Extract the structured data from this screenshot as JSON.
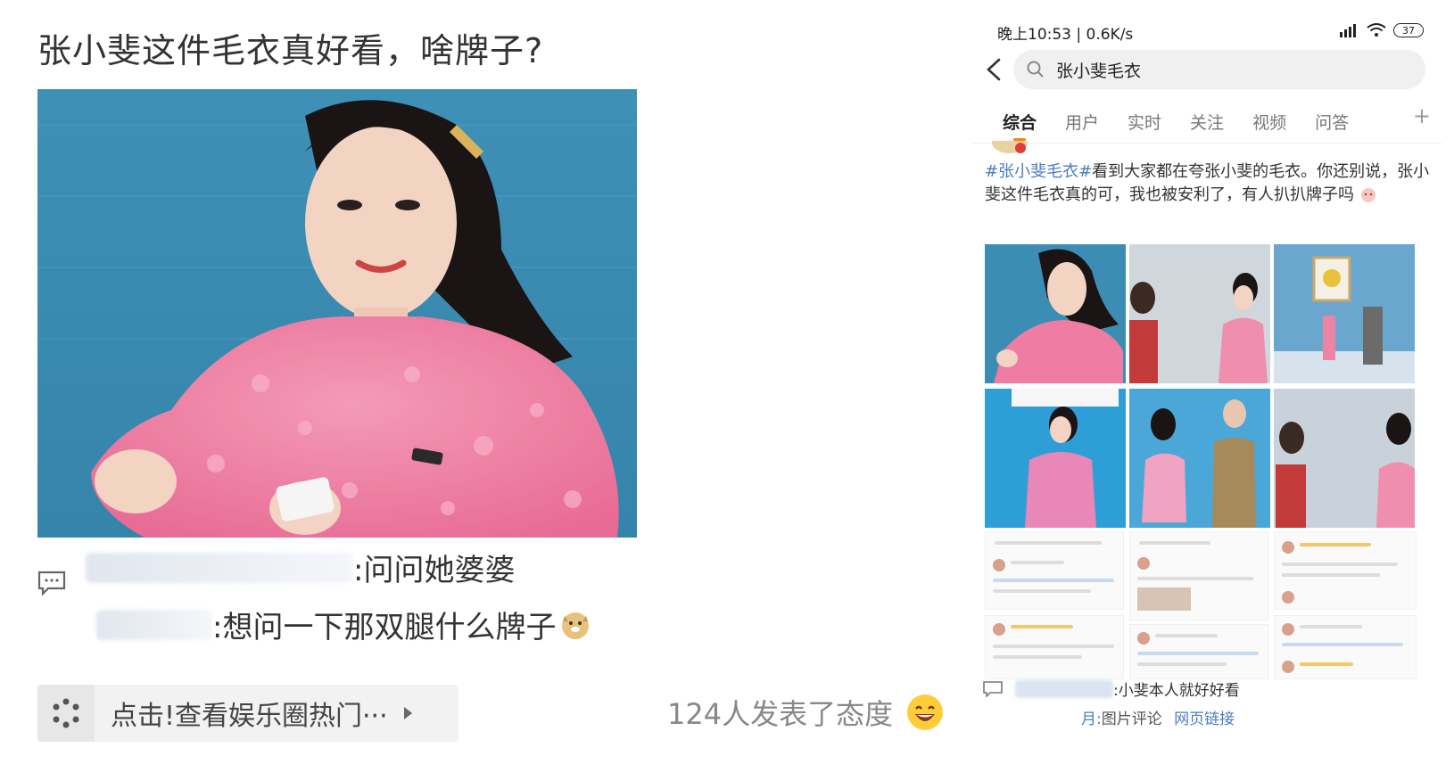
{
  "post": {
    "title": "张小斐这件毛衣真好看，啥牌子?",
    "comment1_text": ":问问她婆婆",
    "comment2_text": ":想问一下那双腿什么牌子",
    "hot_banner_label": "点击!查看娱乐圈热门···",
    "attitude_text": "124人发表了态度"
  },
  "phone": {
    "status_time": "晚上10:53 | 0.6K/s",
    "battery": "37",
    "search_query": "张小斐毛衣",
    "tabs": [
      "综合",
      "用户",
      "实时",
      "关注",
      "视频",
      "问答"
    ],
    "tab_plus": "+",
    "feed": {
      "hashtag": "#张小斐毛衣#",
      "text": "看到大家都在夸张小斐的毛衣。你还别说，张小斐这件毛衣真的可，我也被安利了，有人扒扒牌子吗"
    },
    "bottom_comment": ":小斐本人就好好看",
    "bottom_link1": "图片评论",
    "bottom_link2": "网页链接",
    "bottom_prefix": "月:"
  },
  "colors": {
    "accent": "#ff8200",
    "link": "#4a7ec0",
    "photo_bg": "#3c8db4",
    "sweater": "#f07aa0"
  }
}
